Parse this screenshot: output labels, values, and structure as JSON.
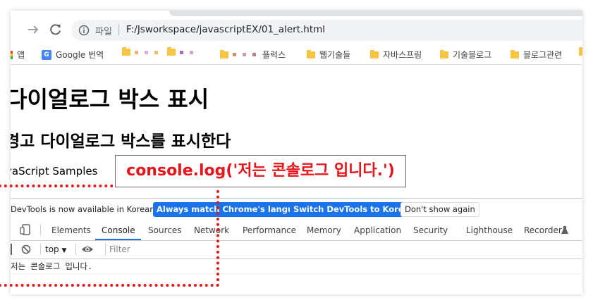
{
  "browser": {
    "site_label": "파일",
    "url": "F:/Jsworkspace/javascriptEX/01_alert.html"
  },
  "bookmarks": {
    "apps": "앱",
    "google_translate": "Google 번역",
    "items": [
      "플럭스",
      "웹기술들",
      "자바스프링",
      "기술블로그",
      "블로그관련"
    ]
  },
  "page": {
    "h1": "다이얼로그 박스 표시",
    "h2": "경고 다이얼로그 박스를 표시한다",
    "paragraph": "vaScript Samples"
  },
  "devtools": {
    "info_message": "DevTools is now available in Korean!",
    "btn_match_language": "Always match Chrome's language",
    "btn_switch_korean": "Switch DevTools to Korean",
    "btn_dont_show": "Don't show again",
    "tabs": [
      "Elements",
      "Console",
      "Sources",
      "Network",
      "Performance",
      "Memory",
      "Application",
      "Security",
      "Lighthouse",
      "Recorder"
    ],
    "active_tab": "Console",
    "context": "top",
    "filter_placeholder": "Filter",
    "log_output": "저는 콘솔로그 입니다."
  },
  "annotation": {
    "callout": "console.log('저는 콘솔로그 입니다.')"
  },
  "colors": {
    "accent_blue": "#1a73e8",
    "annotation_red": "#e8141b",
    "folder_yellow": "#f6c543"
  }
}
